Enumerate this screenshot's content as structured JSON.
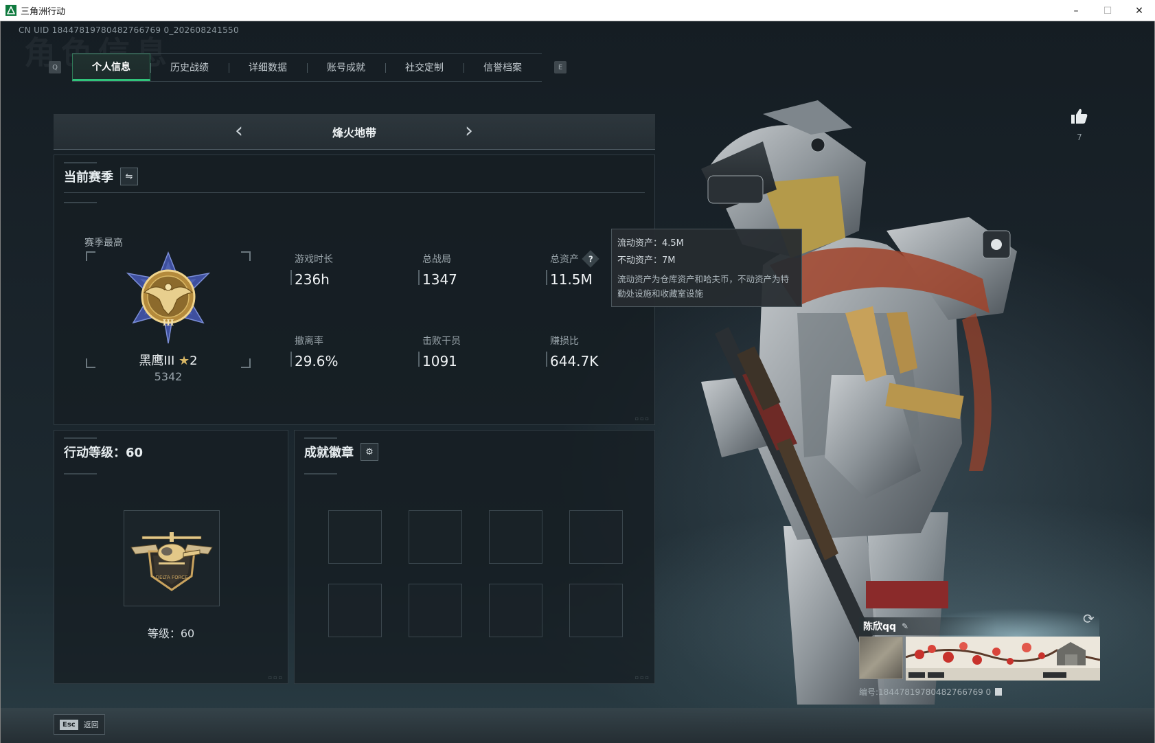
{
  "window": {
    "title": "三角洲行动",
    "minimize": "–",
    "maximize": "☐",
    "close": "✕"
  },
  "uid_line": "CN UID 18447819780482766769 0_202608241550",
  "watermark": "角色信息",
  "tabs": {
    "left_key": "Q",
    "right_key": "E",
    "items": [
      {
        "label": "个人信息",
        "active": true
      },
      {
        "label": "历史战绩"
      },
      {
        "label": "详细数据"
      },
      {
        "label": "账号成就"
      },
      {
        "label": "社交定制"
      },
      {
        "label": "信誉档案"
      }
    ]
  },
  "mode": {
    "prev": "‹",
    "next": "›",
    "title": "烽火地带"
  },
  "season": {
    "title": "当前赛季",
    "best_label": "赛季最高",
    "rank_name": "黑鹰III",
    "rank_stars": "2",
    "rank_score": "5342",
    "stats": [
      {
        "label": "游戏时长",
        "value": "236h"
      },
      {
        "label": "总战局",
        "value": "1347"
      },
      {
        "label": "总资产",
        "value": "11.5M",
        "help": "?"
      },
      {
        "label": "撤离率",
        "value": "29.6%"
      },
      {
        "label": "击败干员",
        "value": "1091"
      },
      {
        "label": "赚损比",
        "value": "644.7K"
      }
    ]
  },
  "tooltip": {
    "liquid": "流动资产：4.5M",
    "fixed": "不动资产：7M",
    "note": "流动资产为仓库资产和哈夫币，不动资产为特勤处设施和收藏室设施"
  },
  "level": {
    "title": "行动等级：60",
    "text": "等级：60"
  },
  "badges": {
    "title": "成就徽章",
    "slot_count": 8
  },
  "like": {
    "count": "7"
  },
  "player": {
    "name": "陈欣qq",
    "id_text": "编号:18447819780482766769 0"
  },
  "bottom": {
    "esc_key": "Esc",
    "esc_label": "返回"
  },
  "colors": {
    "accent_green": "#31c47b",
    "gold": "#d9b765"
  }
}
